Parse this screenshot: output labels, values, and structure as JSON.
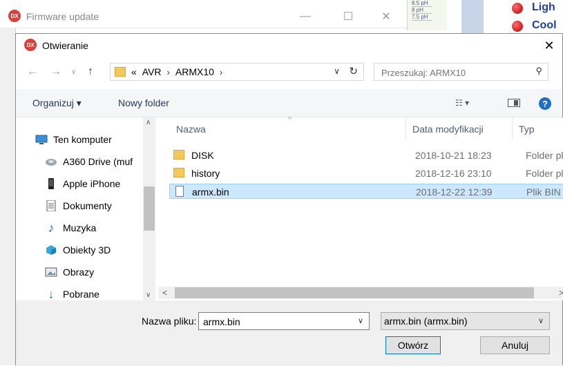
{
  "background_window": {
    "title": "Firmware update",
    "gauge_labels": [
      "8.5 pH",
      "8 pH",
      "7.5 pH"
    ],
    "indicators": [
      "Ligh",
      "Cool"
    ]
  },
  "dialog": {
    "title": "Otwieranie",
    "breadcrumb": [
      "«",
      "AVR",
      "ARMX10"
    ],
    "search_placeholder": "Przeszukaj: ARMX10",
    "toolbar": {
      "organize_label": "Organizuj ▾",
      "new_folder_label": "Nowy folder"
    },
    "nav_items": [
      {
        "label": "Ten komputer",
        "icon": "computer-icon"
      },
      {
        "label": "A360 Drive (muf",
        "icon": "cloud-drive-icon"
      },
      {
        "label": "Apple iPhone",
        "icon": "phone-icon"
      },
      {
        "label": "Dokumenty",
        "icon": "documents-icon"
      },
      {
        "label": "Muzyka",
        "icon": "music-icon"
      },
      {
        "label": "Obiekty 3D",
        "icon": "cube-icon"
      },
      {
        "label": "Obrazy",
        "icon": "pictures-icon"
      },
      {
        "label": "Pobrane",
        "icon": "download-icon"
      }
    ],
    "columns": {
      "name": "Nazwa",
      "date": "Data modyfikacji",
      "type": "Typ"
    },
    "files": [
      {
        "name": "DISK",
        "date": "2018-10-21 18:23",
        "type": "Folder pli",
        "kind": "folder",
        "selected": false
      },
      {
        "name": "history",
        "date": "2018-12-16 23:10",
        "type": "Folder pli",
        "kind": "folder",
        "selected": false
      },
      {
        "name": "armx.bin",
        "date": "2018-12-22 12:39",
        "type": "Plik BIN",
        "kind": "file",
        "selected": true
      }
    ],
    "filename_label": "Nazwa pliku:",
    "filename_value": "armx.bin",
    "filetype_value": "armx.bin (armx.bin)",
    "open_label": "Otwórz",
    "cancel_label": "Anuluj"
  }
}
